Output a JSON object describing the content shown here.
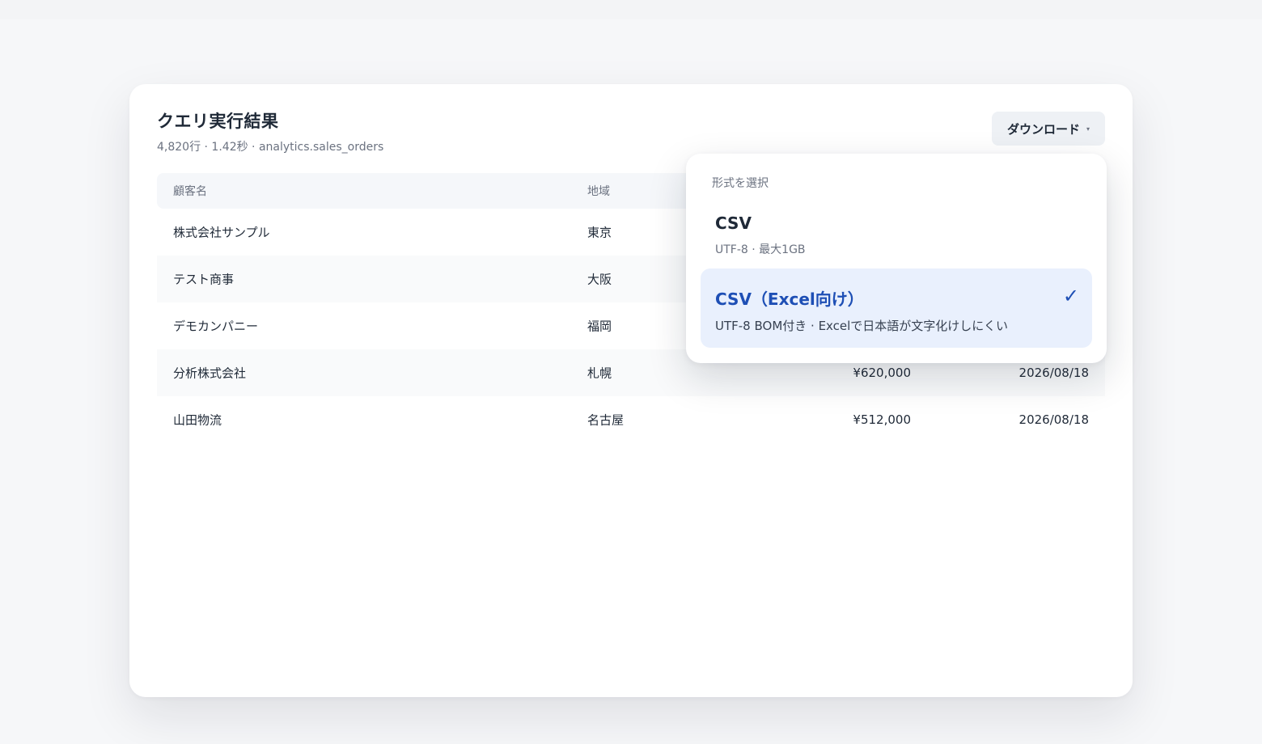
{
  "header": {
    "title": "クエリ実行結果",
    "subtitle": "4,820行 · 1.42秒 · analytics.sales_orders",
    "download_label": "ダウンロード",
    "download_caret": "▾"
  },
  "table": {
    "columns": [
      "顧客名",
      "地域"
    ],
    "rows": [
      {
        "name": "株式会社サンプル",
        "region": "東京",
        "amount": "",
        "date": ""
      },
      {
        "name": "テスト商事",
        "region": "大阪",
        "amount": "",
        "date": ""
      },
      {
        "name": "デモカンパニー",
        "region": "福岡",
        "amount": "",
        "date": ""
      },
      {
        "name": "分析株式会社",
        "region": "札幌",
        "amount": "¥620,000",
        "date": "2026/08/18"
      },
      {
        "name": "山田物流",
        "region": "名古屋",
        "amount": "¥512,000",
        "date": "2026/08/18"
      }
    ]
  },
  "dropdown": {
    "label": "形式を選択",
    "options": [
      {
        "title": "CSV",
        "desc": "UTF-8 · 最大1GB",
        "selected": false
      },
      {
        "title": "CSV（Excel向け）",
        "desc": "UTF-8 BOM付き · Excelで日本語が文字化けしにくい",
        "selected": true
      }
    ],
    "check_glyph": "✓"
  },
  "colors": {
    "accent": "#1e4fb5",
    "selected_bg": "#e9f0fd",
    "page_bg": "#f6f7f9"
  }
}
